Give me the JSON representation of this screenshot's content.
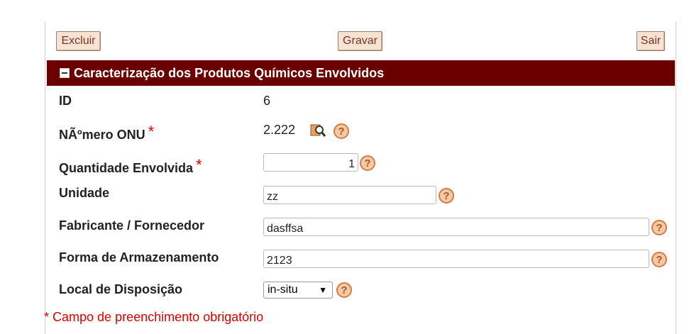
{
  "toolbar": {
    "delete_label": "Excluir",
    "save_label": "Gravar",
    "exit_label": "Sair"
  },
  "section": {
    "title": "Caracterização dos Produtos Químicos Envolvidos"
  },
  "fields": {
    "id": {
      "label": "ID",
      "value": "6"
    },
    "onu": {
      "label": "NÃºmero ONU",
      "required_mark": "*",
      "value": "2.222"
    },
    "quantity": {
      "label": "Quantidade Envolvida",
      "required_mark": "*",
      "value": "1"
    },
    "unit": {
      "label": "Unidade",
      "value": "zz"
    },
    "manufacturer": {
      "label": "Fabricante / Fornecedor",
      "value": "dasffsa"
    },
    "storage": {
      "label": "Forma de Armazenamento",
      "value": "2123"
    },
    "disposal": {
      "label": "Local de Disposição",
      "value": "in-situ"
    }
  },
  "help_glyph": "?",
  "select_arrow": "▼",
  "footnote": "* Campo de preenchimento obrigatório",
  "colors": {
    "header_bg": "#6b0000",
    "button_bg": "#f7e3d3",
    "button_text": "#7a3520",
    "required": "#e00000",
    "help_fill": "#f3c9a6",
    "help_border": "#d87a45"
  },
  "icons": [
    "lookup-magnifier-icon",
    "help-icon",
    "collapse-icon",
    "dropdown-arrow-icon"
  ]
}
